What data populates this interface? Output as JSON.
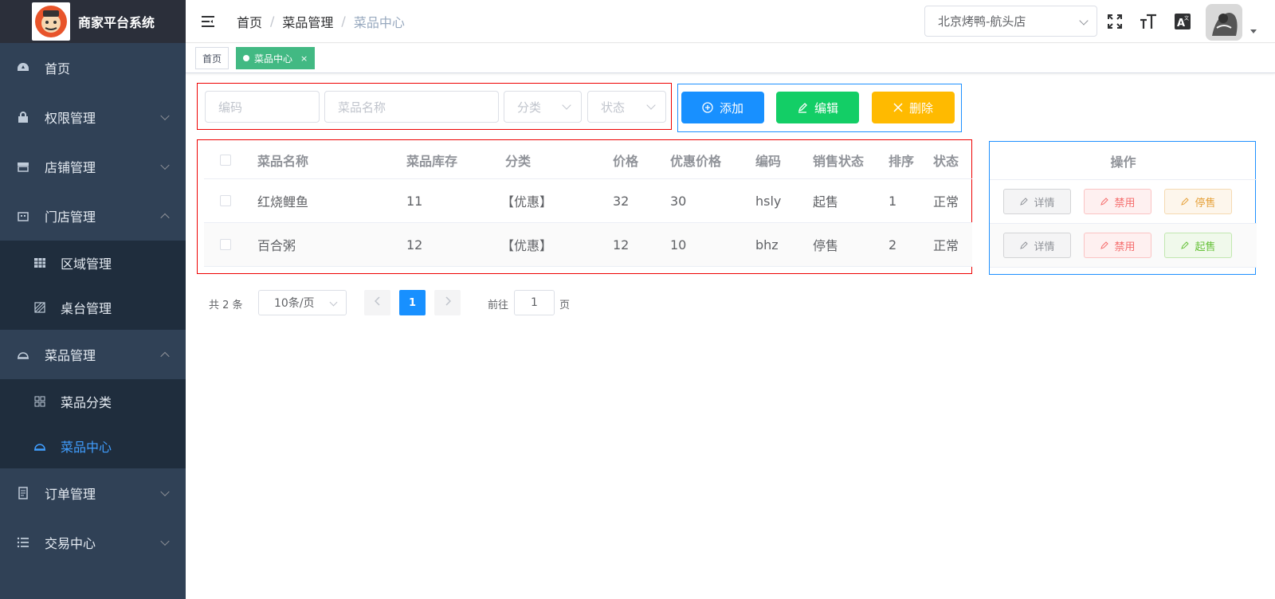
{
  "app": {
    "title": "商家平台系统"
  },
  "sidebar": {
    "items": [
      {
        "label": "首页"
      },
      {
        "label": "权限管理"
      },
      {
        "label": "店铺管理"
      },
      {
        "label": "门店管理"
      },
      {
        "label": "区域管理"
      },
      {
        "label": "桌台管理"
      },
      {
        "label": "菜品管理"
      },
      {
        "label": "菜品分类"
      },
      {
        "label": "菜品中心"
      },
      {
        "label": "订单管理"
      },
      {
        "label": "交易中心"
      }
    ]
  },
  "header": {
    "breadcrumb": [
      "首页",
      "菜品管理",
      "菜品中心"
    ],
    "store": "北京烤鸭-航头店"
  },
  "tags": [
    {
      "label": "首页"
    },
    {
      "label": "菜品中心"
    }
  ],
  "filter": {
    "code_placeholder": "编码",
    "name_placeholder": "菜品名称",
    "category_placeholder": "分类",
    "status_placeholder": "状态"
  },
  "actions": {
    "add": "添加",
    "edit": "编辑",
    "delete": "删除"
  },
  "table": {
    "headers": [
      "菜品名称",
      "菜品库存",
      "分类",
      "价格",
      "优惠价格",
      "编码",
      "销售状态",
      "排序",
      "状态"
    ],
    "op_header": "操作",
    "rows": [
      {
        "name": "红烧鲤鱼",
        "stock": "11",
        "category": "【优惠】",
        "price": "32",
        "discount": "30",
        "code": "hsly",
        "sale": "起售",
        "sort": "1",
        "status": "正常",
        "btn_detail": "详情",
        "btn_disable": "禁用",
        "btn_toggle": "停售"
      },
      {
        "name": "百合粥",
        "stock": "12",
        "category": "【优惠】",
        "price": "12",
        "discount": "10",
        "code": "bhz",
        "sale": "停售",
        "sort": "2",
        "status": "正常",
        "btn_detail": "详情",
        "btn_disable": "禁用",
        "btn_toggle": "起售"
      }
    ]
  },
  "pagination": {
    "total": "共 2 条",
    "page_size": "10条/页",
    "current": "1",
    "goto_label": "前往",
    "goto_value": "1",
    "page_suffix": "页"
  }
}
